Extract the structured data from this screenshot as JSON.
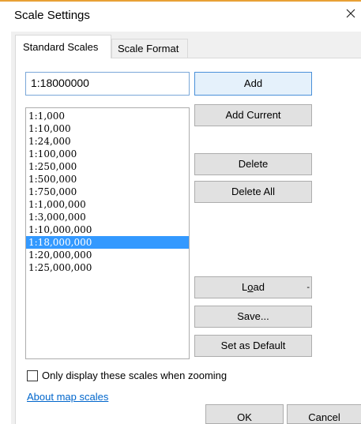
{
  "dialog": {
    "title": "Scale Settings"
  },
  "tabs": [
    {
      "label": "Standard Scales",
      "active": true
    },
    {
      "label": "Scale Format",
      "active": false
    }
  ],
  "scale_input": {
    "value": "1:18000000"
  },
  "scales_list": {
    "items": [
      "1:1,000",
      "1:10,000",
      "1:24,000",
      "1:100,000",
      "1:250,000",
      "1:500,000",
      "1:750,000",
      "1:1,000,000",
      "1:3,000,000",
      "1:10,000,000",
      "1:18,000,000",
      "1:20,000,000",
      "1:25,000,000"
    ],
    "selected": "1:18,000,000"
  },
  "buttons": {
    "add": "Add",
    "add_current": "Add Current",
    "delete": "Delete",
    "delete_all": "Delete All",
    "load_prefix": "L",
    "load_underlined": "o",
    "load_suffix": "ad",
    "load_arrow": "-",
    "save": "Save...",
    "set_default": "Set as Default",
    "ok": "OK",
    "cancel": "Cancel"
  },
  "checkbox": {
    "label": "Only display these scales when zooming",
    "checked": false
  },
  "link": {
    "label": "About map scales"
  },
  "colors": {
    "selection": "#3399ff",
    "link": "#0066cc",
    "title_accent": "#e8a035"
  },
  "icons": {
    "close": "close-icon"
  }
}
